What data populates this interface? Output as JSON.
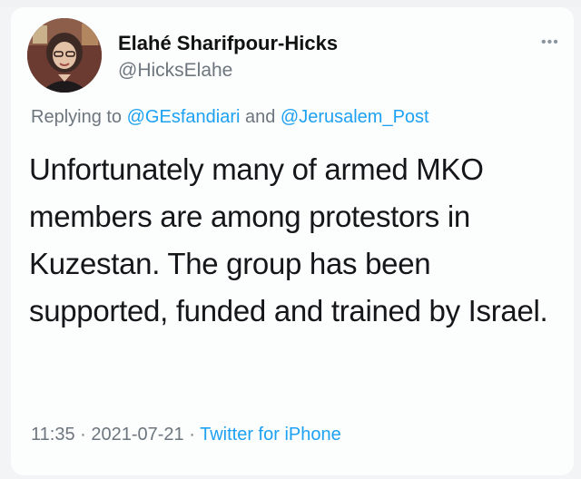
{
  "tweet": {
    "author_name": "Elahé Sharifpour-Hicks",
    "author_handle": "@HicksElahe",
    "more_icon": "more-options-icon",
    "reply_prefix": "Replying to ",
    "reply_to_1": "@GEsfandiari",
    "reply_connector": " and ",
    "reply_to_2": "@Jerusalem_Post",
    "text": "Unfortunately many of armed MKO members are among protestors in Kuzestan. The group has been supported, funded and trained by Israel.",
    "time": "11:35",
    "separator_1": " · ",
    "date": "2021-07-21",
    "separator_2": " · ",
    "source": "Twitter for iPhone"
  },
  "colors": {
    "link": "#1da1f2",
    "muted": "#6d767e",
    "text": "#141619"
  }
}
